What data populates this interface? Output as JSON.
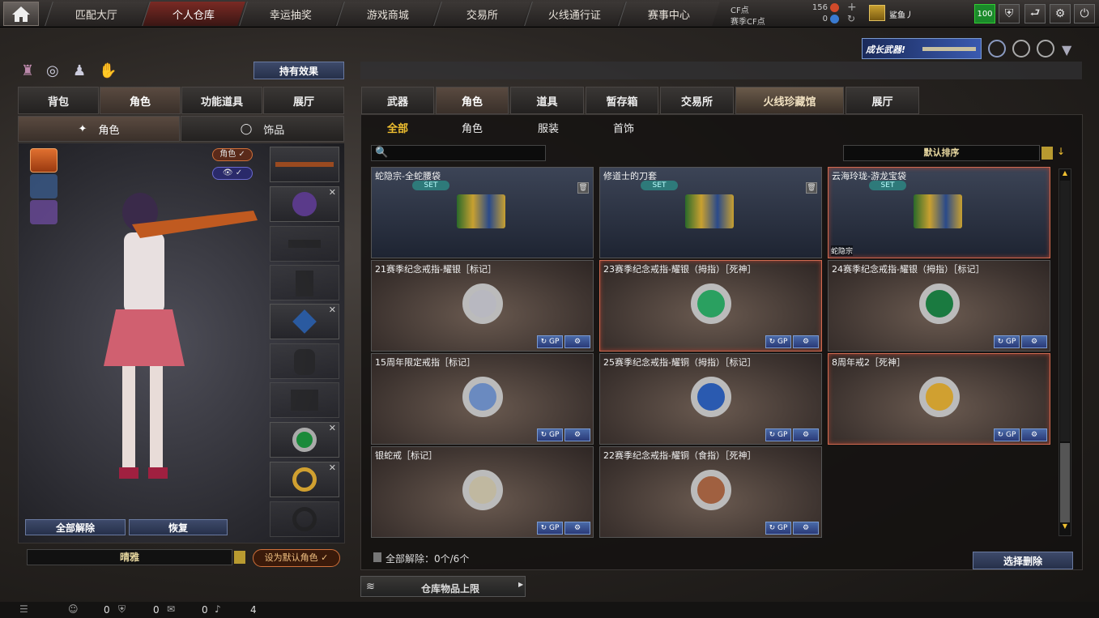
{
  "nav": {
    "tabs": [
      "匹配大厅",
      "个人仓库",
      "幸运抽奖",
      "游戏商城",
      "交易所",
      "火线通行证",
      "赛事中心"
    ],
    "active_index": 1
  },
  "currency": {
    "cf_label": "CF点",
    "cf_value": "156",
    "season_label": "赛季CF点",
    "season_value": "0",
    "player_name": "鲨鱼丿",
    "level": "100"
  },
  "banner": {
    "text": "成长武器!"
  },
  "left": {
    "effects_button": "持有效果",
    "tabs": [
      "背包",
      "角色",
      "功能道具",
      "展厅"
    ],
    "active_tab": 1,
    "subtabs": [
      "角色",
      "饰品"
    ],
    "active_subtab": 0,
    "role_badge": "角色",
    "unequip_all": "全部解除",
    "restore": "恢复",
    "role_name": "晴雅",
    "set_default": "设为默认角色"
  },
  "right": {
    "tabs": [
      "武器",
      "角色",
      "道具",
      "暂存箱",
      "交易所",
      "火线珍藏馆",
      "展厅"
    ],
    "active_tab": 5,
    "subtabs": [
      "全部",
      "角色",
      "服装",
      "首饰"
    ],
    "active_subtab": 0,
    "sort": "默认排序",
    "search_placeholder": "",
    "unequip_status": "全部解除：0个/6个",
    "select_delete": "选择删除",
    "storage_limit": "仓库物品上限"
  },
  "items": [
    {
      "title": "蛇隐宗-全蛇腰袋",
      "type": "set",
      "set": "SET",
      "trash": true,
      "selected": false
    },
    {
      "title": "修道士的刀套",
      "type": "set",
      "set": "SET",
      "trash": true,
      "selected": false
    },
    {
      "title": "云海玲珑-游龙宝袋",
      "type": "set",
      "set": "SET",
      "trash": false,
      "selected": true,
      "tag": "蛇隐宗"
    },
    {
      "title": "21赛季纪念戒指-耀银［标记］",
      "type": "ring",
      "selected": false,
      "color": "#b8b8c0"
    },
    {
      "title": "23赛季纪念戒指-耀银（拇指）［死神］",
      "type": "ring",
      "selected": true,
      "color": "#2aa060"
    },
    {
      "title": "24赛季纪念戒指-耀银（拇指）［标记］",
      "type": "ring",
      "selected": false,
      "color": "#1a7a40"
    },
    {
      "title": "15周年限定戒指［标记］",
      "type": "ring",
      "selected": false,
      "color": "#6a8ac0"
    },
    {
      "title": "25赛季纪念戒指-耀铜（拇指）［标记］",
      "type": "ring",
      "selected": false,
      "color": "#2a5ab0"
    },
    {
      "title": "8周年戒2［死神］",
      "type": "ring",
      "selected": true,
      "color": "#d0a030"
    },
    {
      "title": "银蛇戒［标记］",
      "type": "ring",
      "selected": false,
      "color": "#c0b8a0"
    },
    {
      "title": "22赛季纪念戒指-耀铜（食指）［死神］",
      "type": "ring",
      "selected": false,
      "color": "#a06040"
    }
  ],
  "card_buttons": {
    "gp": "GP"
  },
  "bottom": {
    "v1": "0",
    "v2": "0",
    "v3": "0",
    "v4": "4"
  }
}
